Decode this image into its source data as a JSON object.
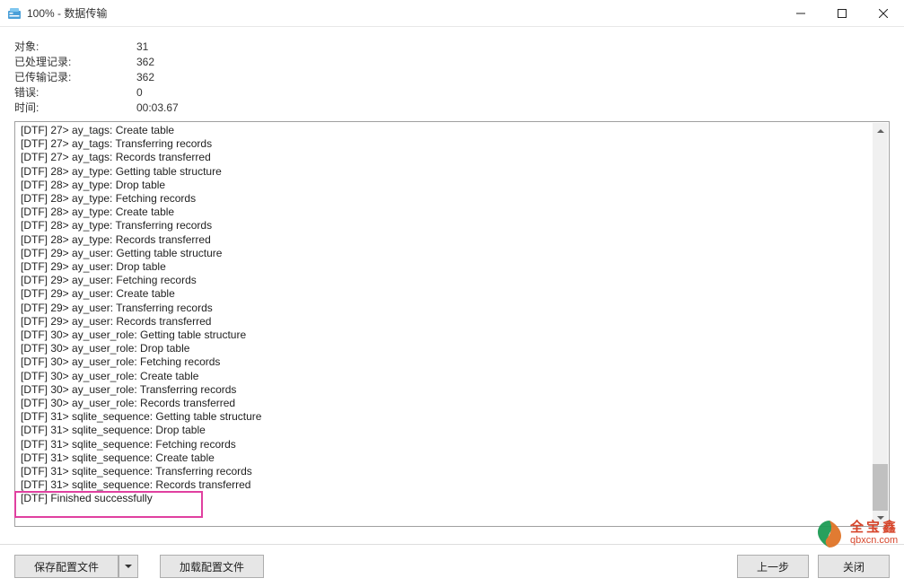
{
  "window": {
    "title": "100% - 数据传输"
  },
  "stats": {
    "objects_label": "对象:",
    "objects_value": "31",
    "processed_label": "已处理记录:",
    "processed_value": "362",
    "transferred_label": "已传输记录:",
    "transferred_value": "362",
    "errors_label": "错误:",
    "errors_value": "0",
    "time_label": "时间:",
    "time_value": "00:03.67"
  },
  "log": [
    "[DTF] 27> ay_tags: Create table",
    "[DTF] 27> ay_tags: Transferring records",
    "[DTF] 27> ay_tags: Records transferred",
    "[DTF] 28> ay_type: Getting table structure",
    "[DTF] 28> ay_type: Drop table",
    "[DTF] 28> ay_type: Fetching records",
    "[DTF] 28> ay_type: Create table",
    "[DTF] 28> ay_type: Transferring records",
    "[DTF] 28> ay_type: Records transferred",
    "[DTF] 29> ay_user: Getting table structure",
    "[DTF] 29> ay_user: Drop table",
    "[DTF] 29> ay_user: Fetching records",
    "[DTF] 29> ay_user: Create table",
    "[DTF] 29> ay_user: Transferring records",
    "[DTF] 29> ay_user: Records transferred",
    "[DTF] 30> ay_user_role: Getting table structure",
    "[DTF] 30> ay_user_role: Drop table",
    "[DTF] 30> ay_user_role: Fetching records",
    "[DTF] 30> ay_user_role: Create table",
    "[DTF] 30> ay_user_role: Transferring records",
    "[DTF] 30> ay_user_role: Records transferred",
    "[DTF] 31> sqlite_sequence: Getting table structure",
    "[DTF] 31> sqlite_sequence: Drop table",
    "[DTF] 31> sqlite_sequence: Fetching records",
    "[DTF] 31> sqlite_sequence: Create table",
    "[DTF] 31> sqlite_sequence: Transferring records",
    "[DTF] 31> sqlite_sequence: Records transferred",
    "[DTF] Finished successfully"
  ],
  "buttons": {
    "save_profile": "保存配置文件",
    "load_profile": "加载配置文件",
    "prev_step": "上一步",
    "close": "关闭"
  },
  "watermark": {
    "name": "全宝鑫",
    "domain": "qbxcn.com"
  }
}
